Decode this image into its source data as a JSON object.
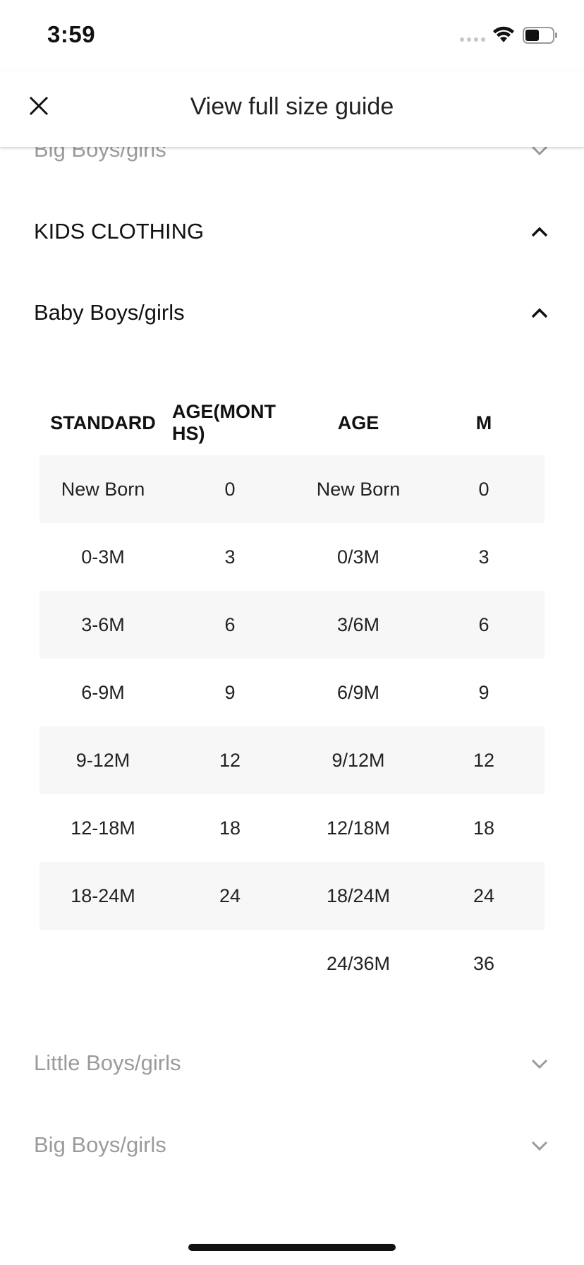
{
  "status_bar": {
    "time": "3:59"
  },
  "header": {
    "title": "View full size guide"
  },
  "sections": {
    "top_partial": {
      "label": "Big Boys/girls"
    },
    "kids_clothing": {
      "label": "KIDS CLOTHING"
    },
    "baby": {
      "label": "Baby Boys/girls"
    },
    "little": {
      "label": "Little Boys/girls"
    },
    "big": {
      "label": "Big Boys/girls"
    }
  },
  "table": {
    "headers": [
      "STANDARD",
      "AGE(MONTHS)",
      "AGE",
      "M"
    ],
    "header_wrap": {
      "age_months_line1": "AGE(MONT",
      "age_months_line2": "HS)"
    },
    "rows": [
      [
        "New Born",
        "0",
        "New Born",
        "0"
      ],
      [
        "0-3M",
        "3",
        "0/3M",
        "3"
      ],
      [
        "3-6M",
        "6",
        "3/6M",
        "6"
      ],
      [
        "6-9M",
        "9",
        "6/9M",
        "9"
      ],
      [
        "9-12M",
        "12",
        "9/12M",
        "12"
      ],
      [
        "12-18M",
        "18",
        "12/18M",
        "18"
      ],
      [
        "18-24M",
        "24",
        "18/24M",
        "24"
      ],
      [
        "",
        "",
        "24/36M",
        "36"
      ]
    ]
  },
  "colors": {
    "row_shade": "#f7f7f7",
    "muted_text": "#9b9b9b"
  }
}
